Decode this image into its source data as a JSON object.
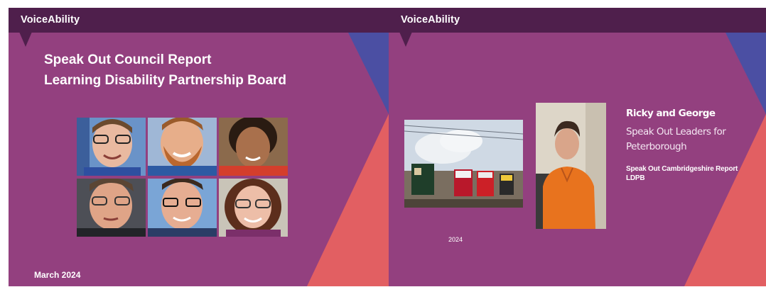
{
  "slides": [
    {
      "brand": "VoiceAbility",
      "title_line1": "Speak Out Council Report",
      "title_line2": "Learning Disability Partnership Board",
      "date": "March 2024"
    },
    {
      "brand": "VoiceAbility",
      "name": "Ricky and George",
      "role_line1": "Speak Out Leaders for",
      "role_line2": "Peterborough",
      "report_line1": "Speak Out Cambridgeshire Report",
      "report_line2": "LDPB",
      "year": "2024"
    }
  ],
  "colors": {
    "slide_background": "#93407f",
    "header_bar": "#4f1f4c",
    "accent_blue": "#4b4fa3",
    "accent_coral": "#e25f62"
  }
}
